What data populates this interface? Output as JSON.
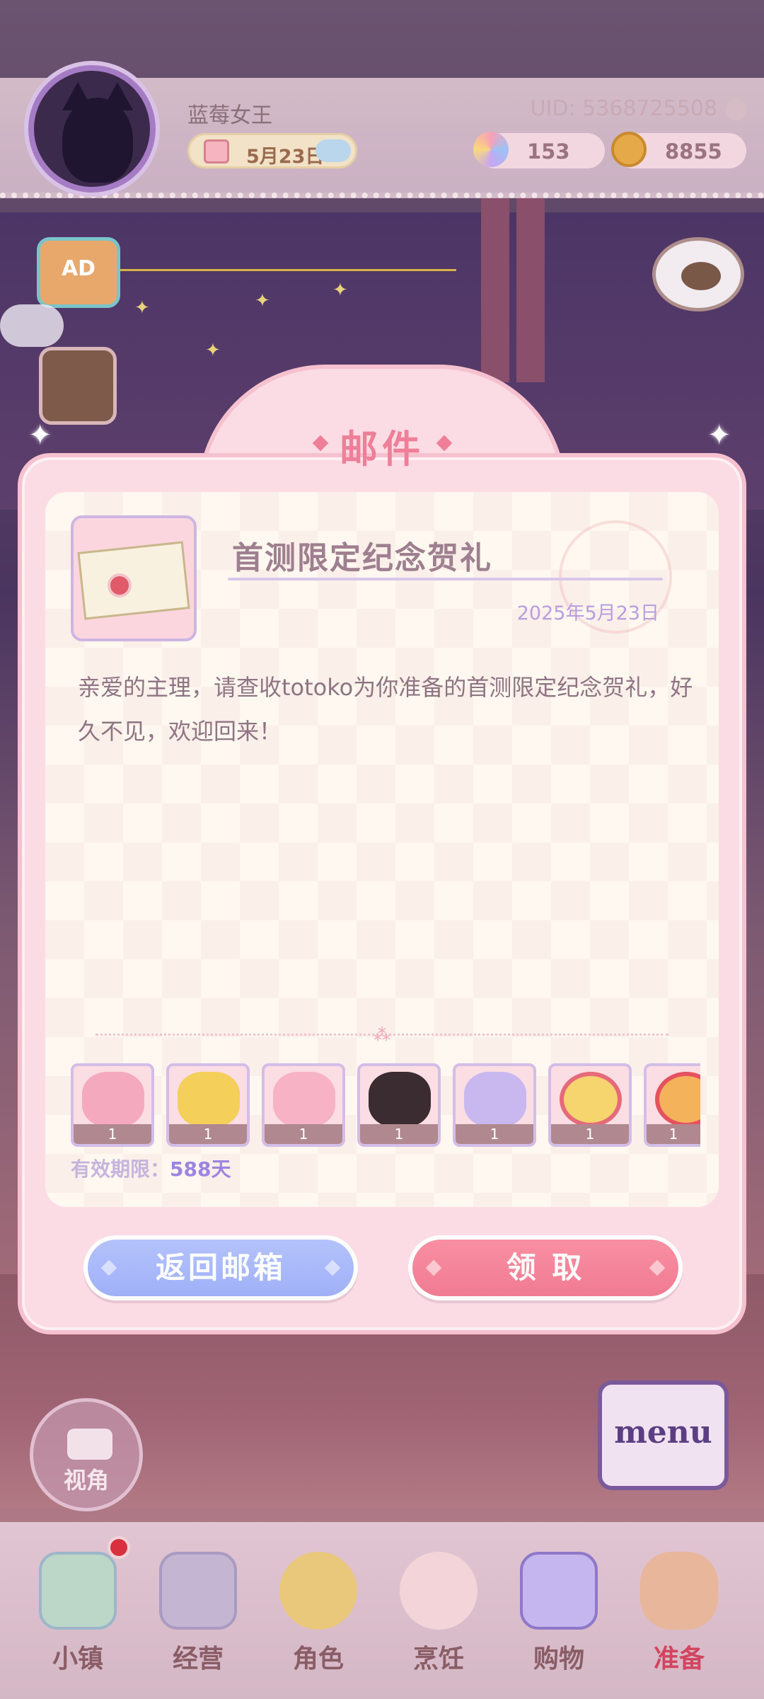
{
  "hud": {
    "username": "蓝莓女王",
    "uid": "UID: 5368725508",
    "date": "5月23日",
    "gems": "153",
    "coins": "8855"
  },
  "side": {
    "ad_label": "AD"
  },
  "mail_dialog": {
    "title": "邮件",
    "mail_title": "首测限定纪念贺礼",
    "mail_date": "2025年5月23日",
    "body": "亲爱的主理，请查收totoko为你准备的首测限定纪念贺礼，好久不见，欢迎回来！",
    "rewards": [
      {
        "icon": "pink-vanity-item",
        "count": "1"
      },
      {
        "icon": "yellow-headdress-item",
        "count": "1"
      },
      {
        "icon": "pink-dress-item",
        "count": "1"
      },
      {
        "icon": "maid-outfit-item",
        "count": "1"
      },
      {
        "icon": "purple-bear-item",
        "count": "1"
      },
      {
        "icon": "strawberry-hair-item",
        "count": "1"
      },
      {
        "icon": "red-hair-item",
        "count": "1"
      }
    ],
    "expiry_label": "有效期限：",
    "expiry_value": "588天",
    "back_button": "返回邮箱",
    "claim_button": "领 取"
  },
  "camera": {
    "label": "视角"
  },
  "menu_book": {
    "label": "menu"
  },
  "bottom_nav": {
    "items": [
      {
        "label": "小镇",
        "icon": "town-map-icon"
      },
      {
        "label": "经营",
        "icon": "shop-bag-icon"
      },
      {
        "label": "角色",
        "icon": "character-icon"
      },
      {
        "label": "烹饪",
        "icon": "cooking-icon"
      },
      {
        "label": "购物",
        "icon": "shopping-bag-icon"
      },
      {
        "label": "准备",
        "icon": "prepare-basket-icon"
      }
    ]
  },
  "colors": {
    "accent_pink": "#ef7f98",
    "back_blue": "#a8b8f9",
    "claim_pink": "#f48599"
  }
}
